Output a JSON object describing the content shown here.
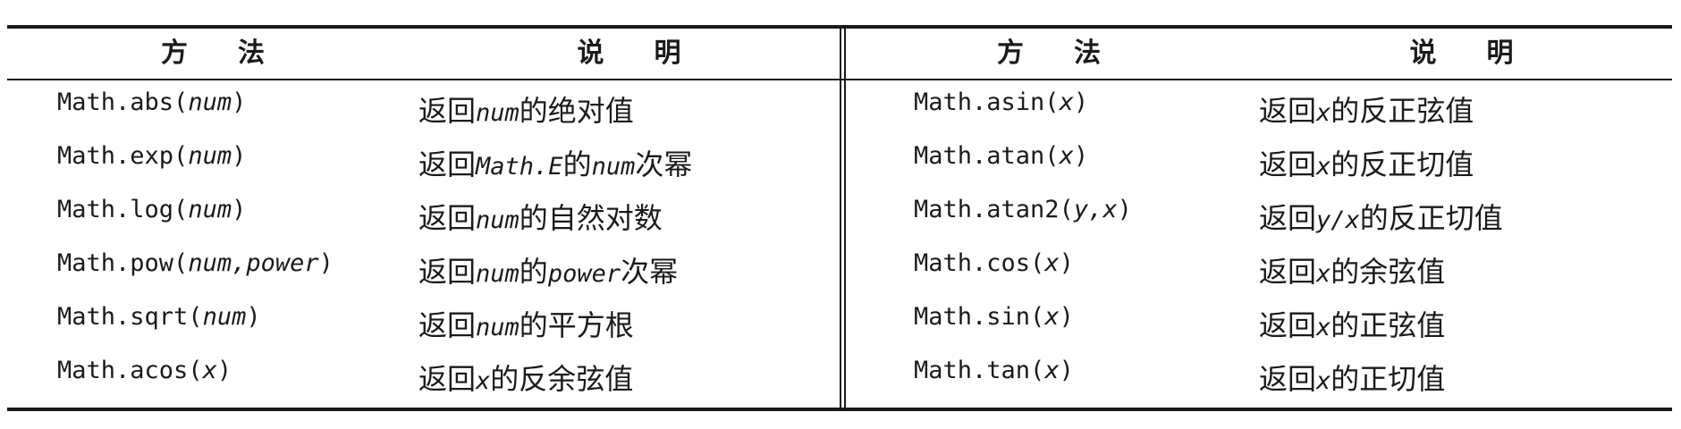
{
  "headers": {
    "method": "方法",
    "description": "说明"
  },
  "left_rows": [
    {
      "method_name": "Math.abs(",
      "method_arg": "num",
      "method_close": ")",
      "desc_pre": "返回",
      "desc_code": "num",
      "desc_post": "的绝对值",
      "desc_code2": "",
      "desc_post2": ""
    },
    {
      "method_name": "Math.exp(",
      "method_arg": "num",
      "method_close": ")",
      "desc_pre": "返回",
      "desc_code": "Math.E",
      "desc_post": "的",
      "desc_code2": "num",
      "desc_post2": "次幂"
    },
    {
      "method_name": "Math.log(",
      "method_arg": "num",
      "method_close": ")",
      "desc_pre": "返回",
      "desc_code": "num",
      "desc_post": "的自然对数",
      "desc_code2": "",
      "desc_post2": ""
    },
    {
      "method_name": "Math.pow(",
      "method_arg": "num,power",
      "method_close": ")",
      "desc_pre": "返回",
      "desc_code": "num",
      "desc_post": "的",
      "desc_code2": "power",
      "desc_post2": "次幂"
    },
    {
      "method_name": "Math.sqrt(",
      "method_arg": "num",
      "method_close": ")",
      "desc_pre": "返回",
      "desc_code": "num",
      "desc_post": "的平方根",
      "desc_code2": "",
      "desc_post2": ""
    },
    {
      "method_name": "Math.acos(",
      "method_arg": "x",
      "method_close": ")",
      "desc_pre": "返回",
      "desc_code": "x",
      "desc_post": "的反余弦值",
      "desc_code2": "",
      "desc_post2": ""
    }
  ],
  "right_rows": [
    {
      "method_name": "Math.asin(",
      "method_arg": "x",
      "method_close": ")",
      "desc_pre": "返回",
      "desc_code": "x",
      "desc_post": "的反正弦值",
      "desc_code2": "",
      "desc_post2": ""
    },
    {
      "method_name": "Math.atan(",
      "method_arg": "x",
      "method_close": ")",
      "desc_pre": "返回",
      "desc_code": "x",
      "desc_post": "的反正切值",
      "desc_code2": "",
      "desc_post2": ""
    },
    {
      "method_name": "Math.atan2(",
      "method_arg": "y,x",
      "method_close": ")",
      "desc_pre": "返回",
      "desc_code": "y/x",
      "desc_post": "的反正切值",
      "desc_code2": "",
      "desc_post2": ""
    },
    {
      "method_name": "Math.cos(",
      "method_arg": "x",
      "method_close": ")",
      "desc_pre": "返回",
      "desc_code": "x",
      "desc_post": "的余弦值",
      "desc_code2": "",
      "desc_post2": ""
    },
    {
      "method_name": "Math.sin(",
      "method_arg": "x",
      "method_close": ")",
      "desc_pre": "返回",
      "desc_code": "x",
      "desc_post": "的正弦值",
      "desc_code2": "",
      "desc_post2": ""
    },
    {
      "method_name": "Math.tan(",
      "method_arg": "x",
      "method_close": ")",
      "desc_pre": "返回",
      "desc_code": "x",
      "desc_post": "的正切值",
      "desc_code2": "",
      "desc_post2": ""
    }
  ]
}
